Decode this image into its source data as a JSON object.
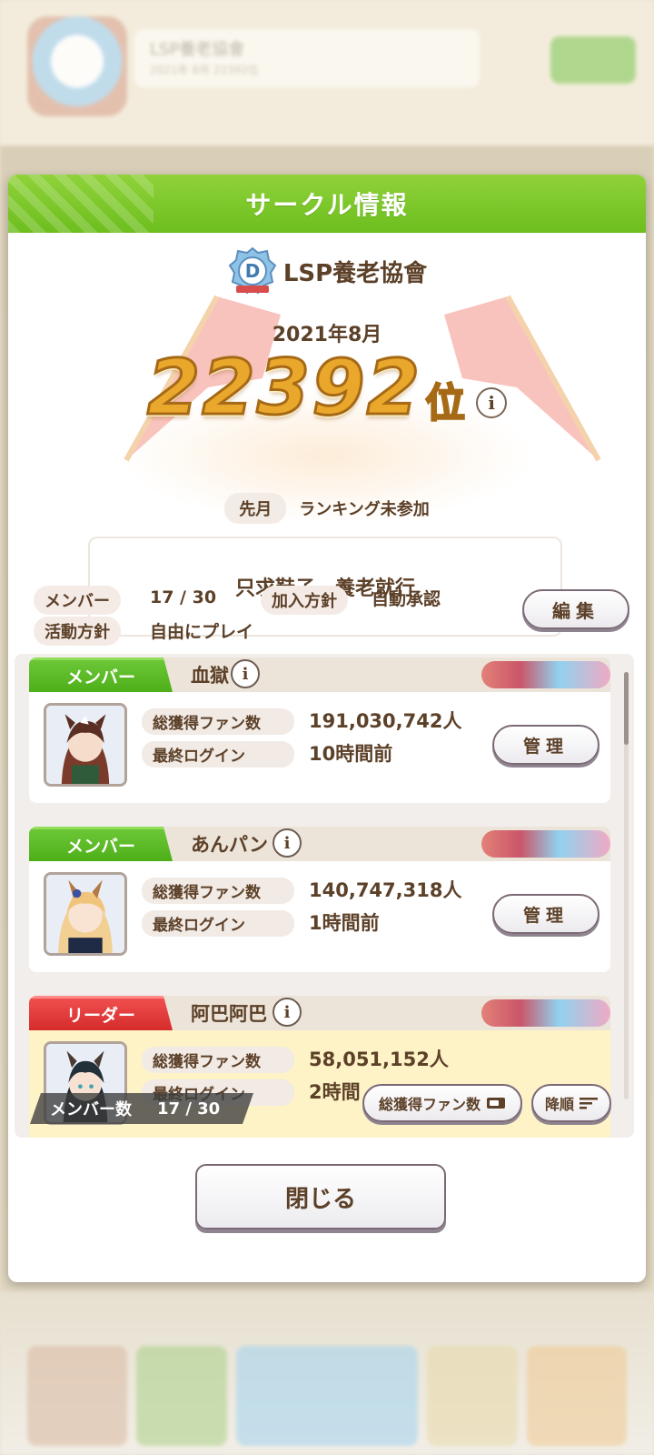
{
  "background": {
    "circle_name": "LSP養老協會",
    "circle_sub": "2021年 8月 22392位"
  },
  "dialog": {
    "title": "サークル情報",
    "circle_name": "LSP養老協會",
    "emblem_letter": "D",
    "month": "2021年8月",
    "rank_number": "22392",
    "rank_unit": "位",
    "info_symbol": "i",
    "prev_month_label": "先月",
    "prev_month_value": "ランキング未参加",
    "slogan": "只求鞋子，養老就行",
    "members_label": "メンバー",
    "members_value": "17 / 30",
    "join_policy_label": "加入方針",
    "join_policy_value": "自動承認",
    "activity_label": "活動方針",
    "activity_value": "自由にプレイ",
    "edit_button": "編集",
    "fans_label": "総獲得ファン数",
    "login_label": "最終ログイン",
    "manage_button": "管理",
    "members": [
      {
        "role": "メンバー",
        "name": "血獄",
        "fans": "191,030,742人",
        "last_login": "10時間前"
      },
      {
        "role": "メンバー",
        "name": "あんパン",
        "fans": "140,747,318人",
        "last_login": "1時間前"
      },
      {
        "role": "リーダー",
        "name": "阿巴阿巴",
        "fans": "58,051,152人",
        "last_login": "2時間"
      }
    ],
    "member_count_label": "メンバー数",
    "member_count_value": "17 / 30",
    "sort_key_button": "総獲得ファン数",
    "sort_order_button": "降順",
    "close_button": "閉じる"
  },
  "colors": {
    "header_green": "#6dbe1e",
    "member_tag_green": "#4eaf19",
    "leader_tag_red": "#d52b2b",
    "rank_gold": "#e9a72c",
    "text_brown": "#5c4028"
  }
}
